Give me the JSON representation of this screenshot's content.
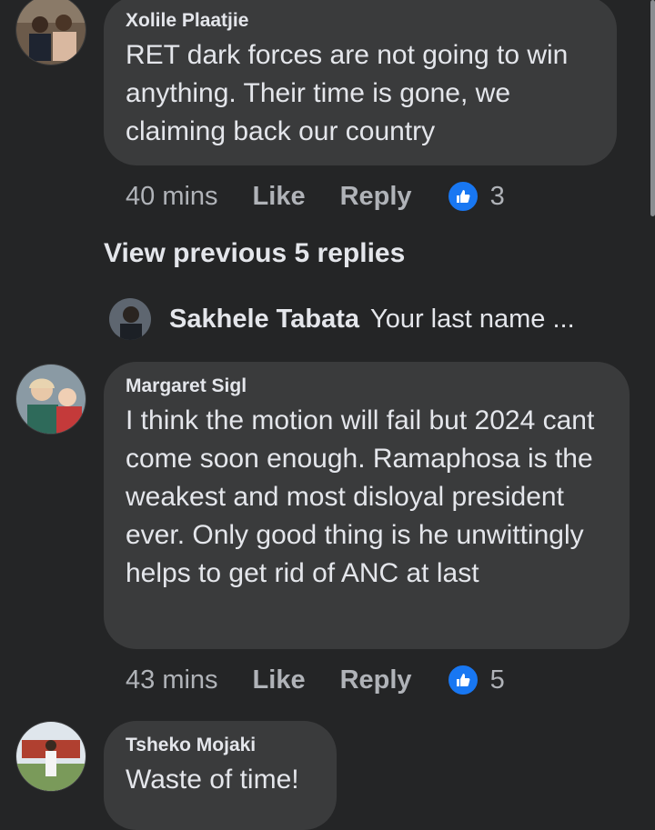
{
  "colors": {
    "background": "#242526",
    "bubble": "#3a3b3c",
    "text": "#e4e6eb",
    "muted": "#b0b3b8",
    "like": "#1877f2"
  },
  "comments": [
    {
      "author": "Xolile Plaatjie",
      "text": "RET dark forces are not going to win anything. Their time is gone, we claiming back our country",
      "time": "40 mins",
      "like_label": "Like",
      "reply_label": "Reply",
      "reaction_icon": "thumbs-up-icon",
      "reaction_count": "3"
    },
    {
      "author": "Margaret Sigl",
      "text": "I think the motion will fail but 2024 cant come soon enough. Ramaphosa is the weakest and most disloyal president ever. Only good thing is he unwittingly  helps to get rid of ANC at last",
      "time": "43 mins",
      "like_label": "Like",
      "reply_label": "Reply",
      "reaction_icon": "thumbs-up-icon",
      "reaction_count": "5"
    },
    {
      "author": "Tsheko Mojaki",
      "text": "Waste of time!"
    }
  ],
  "view_previous": "View previous 5 replies",
  "reply_preview": {
    "author": "Sakhele Tabata",
    "text": "Your last name ..."
  }
}
